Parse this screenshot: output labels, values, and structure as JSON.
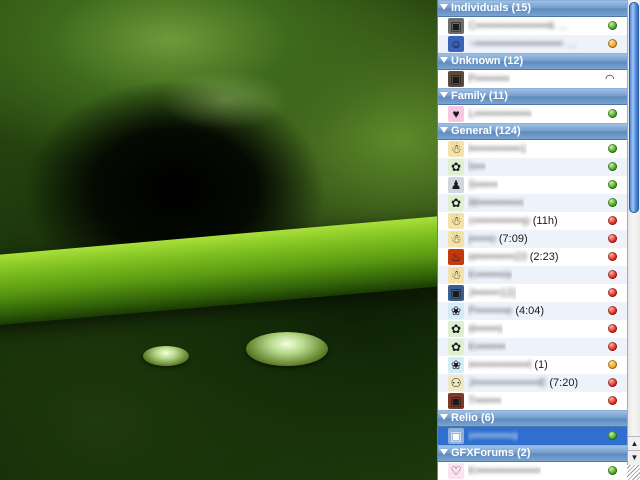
{
  "groups": [
    {
      "title": "Individuals (15)",
      "contacts": [
        {
          "name": "C•••••••••••••••••••k …",
          "icon": "photo-avatar",
          "glyph": "▣",
          "icon_bg": "#6d6d6d",
          "status": "green"
        },
        {
          "name": "~••••••••••••••••••••••• …",
          "icon": "cartoon-avatar",
          "glyph": "☺",
          "icon_bg": "#3a64b8",
          "status": "orange"
        }
      ]
    },
    {
      "title": "Unknown (12)",
      "contacts": [
        {
          "name": "P•••••••••",
          "icon": "photo-avatar",
          "glyph": "▣",
          "icon_bg": "#5a4a3e",
          "status": "wifi"
        }
      ]
    },
    {
      "title": "Family (11)",
      "contacts": [
        {
          "name": "L•••••••••••••••",
          "icon": "pink-avatar",
          "glyph": "♥",
          "icon_bg": "#f6c8e4",
          "status": "green"
        }
      ]
    },
    {
      "title": "General (124)",
      "contacts": [
        {
          "name": "l•••••••••••••1",
          "icon": "aim-running-man-icon",
          "glyph": "☃",
          "icon_bg": "#f4e2a8",
          "status": "green"
        },
        {
          "name": "h•••",
          "icon": "icq-flower-icon",
          "glyph": "✿",
          "icon_bg": "#dff0d0",
          "status": "green"
        },
        {
          "name": "S••••••",
          "icon": "generic-person-icon",
          "glyph": "♟",
          "icon_bg": "#cfd8df",
          "status": "green"
        },
        {
          "name": "W•••••••••••r",
          "icon": "icq-flower-icon",
          "glyph": "✿",
          "icon_bg": "#dff0d0",
          "status": "green"
        },
        {
          "name": "c•••••••••••••p",
          "idle": " (11h)",
          "icon": "aim-running-man-icon",
          "glyph": "☃",
          "icon_bg": "#f4e2a8",
          "status": "red"
        },
        {
          "name": "j•••••o",
          "idle": " (7:09)",
          "icon": "aim-running-man-icon",
          "glyph": "☃",
          "icon_bg": "#f4e2a8",
          "status": "red"
        },
        {
          "name": "w••••••••••23",
          "idle": " (2:23)",
          "icon": "flame-avatar",
          "glyph": "♨",
          "icon_bg": "#c43a10",
          "status": "red"
        },
        {
          "name": "K•••••••re",
          "icon": "aim-running-man-icon",
          "glyph": "☃",
          "icon_bg": "#f4e2a8",
          "status": "red"
        },
        {
          "name": "J•••••••12)",
          "icon": "photo-avatar",
          "glyph": "▣",
          "icon_bg": "#3c5f8c",
          "status": "red"
        },
        {
          "name": "P••••••••e",
          "idle": " (4:04)",
          "icon": "msn-buddy-icon",
          "glyph": "❀",
          "icon_bg": "#d4ecf8",
          "status": "red"
        },
        {
          "name": "d••••••s",
          "icon": "icq-flower-icon",
          "glyph": "✿",
          "icon_bg": "#dff0d0",
          "status": "red"
        },
        {
          "name": "K••••••••",
          "icon": "icq-flower-icon",
          "glyph": "✿",
          "icon_bg": "#dff0d0",
          "status": "red"
        },
        {
          "name": "i•••••••••••••••t",
          "idle": " (1)",
          "icon": "msn-buddy-icon",
          "glyph": "❀",
          "icon_bg": "#d4ecf8",
          "status": "orange"
        },
        {
          "name": "J•••••••••••••••••E",
          "idle": " (7:20)",
          "icon": "yahoo-face-icon",
          "glyph": "⚇",
          "icon_bg": "#f0e8c0",
          "status": "red"
        },
        {
          "name": "T•••••••",
          "icon": "photo-avatar",
          "glyph": "▣",
          "icon_bg": "#7a3a2a",
          "status": "red"
        }
      ]
    },
    {
      "title": "Relio (6)",
      "contacts": [
        {
          "name": "v••••••••••a",
          "icon": "photo-avatar",
          "glyph": "▣",
          "icon_bg": "#8fb0d8",
          "status": "green",
          "selected": true
        }
      ]
    },
    {
      "title": "GFXForums (2)",
      "contacts": [
        {
          "name": "K•••••••••••••••••",
          "icon": "lips-avatar",
          "glyph": "♡",
          "icon_bg": "#fbe4ee",
          "status": "green"
        }
      ]
    }
  ],
  "scrollbar": {
    "thumb_fraction": 0.44,
    "up_arrow": "▲",
    "down_arrow": "▼"
  }
}
